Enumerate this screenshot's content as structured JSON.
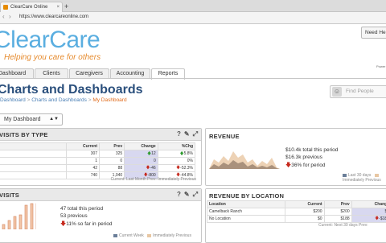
{
  "browser": {
    "tab_title": "ClearCare Online",
    "new_tab": "+",
    "url": "https://www.clearcareonline.com"
  },
  "header": {
    "logo": "ClearCare",
    "tagline": "Helping you care for others",
    "help_button": "Need Help",
    "powered_by": "Power"
  },
  "nav": {
    "tabs": [
      "Dashboard",
      "Clients",
      "Caregivers",
      "Accounting",
      "Reports"
    ],
    "active": "Reports"
  },
  "page": {
    "title": "Charts and Dashboards",
    "breadcrumb": [
      "Dashboard",
      "Charts and Dashboards",
      "My Dashboard"
    ],
    "search_placeholder": "Find People",
    "dashboard_select": "My Dashboard"
  },
  "visits_by_type": {
    "title": "VISITS BY TYPE",
    "icons": [
      "help-icon",
      "pin-icon",
      "expand-icon"
    ],
    "columns": [
      "",
      "Current",
      "Prev",
      "Change",
      "%Chg"
    ],
    "rows": [
      {
        "type": "",
        "current": "307",
        "prev": "325",
        "change": "12",
        "dir": "up",
        "pct": "5.8%"
      },
      {
        "type": "",
        "current": "1",
        "prev": "0",
        "change": "0",
        "dir": "none",
        "pct": "0%"
      },
      {
        "type": "",
        "current": "42",
        "prev": "88",
        "change": "-46",
        "dir": "down",
        "pct": "-52.3%"
      },
      {
        "type": "",
        "current": "740",
        "prev": "1,040",
        "change": "-800",
        "dir": "down",
        "pct": "-44.8%"
      }
    ],
    "footer": "Current: Last Month  Prev: Immediately Previous"
  },
  "revenue": {
    "title": "REVENUE",
    "total": "$10.4k total this period",
    "previous": "$16.3k previous",
    "change": "36% for period",
    "change_dir": "down",
    "legend": [
      "Last 30 days",
      "Immediately Previous"
    ],
    "colors": {
      "current": "#c9a78a",
      "previous": "#e8c7a3"
    }
  },
  "visits": {
    "title": "VISITS",
    "icons": [
      "help-icon",
      "pin-icon",
      "expand-icon"
    ],
    "total": "47 total this period",
    "previous": "53 previous",
    "change": "11% so far in period",
    "change_dir": "down",
    "legend": [
      "Current Week",
      "Immediately Previous"
    ],
    "bar_heights": [
      0.18,
      0.35,
      0.5,
      0.55,
      0.95,
      1.0,
      1.0
    ],
    "colors": {
      "bar": "#f2c6a8",
      "bar_outline": "#d4835f"
    }
  },
  "revenue_by_location": {
    "title": "REVENUE BY LOCATION",
    "columns": [
      "Location",
      "Current",
      "Prev",
      "Change"
    ],
    "rows": [
      {
        "location": "Camelback Ranch",
        "current": "$200",
        "prev": "$200",
        "change": "$0",
        "dir": "none"
      },
      {
        "location": "No Location",
        "current": "$0",
        "prev": "$188",
        "change": "-$188",
        "dir": "down"
      }
    ],
    "footer": "Current: Next 30 days  Prev:"
  }
}
